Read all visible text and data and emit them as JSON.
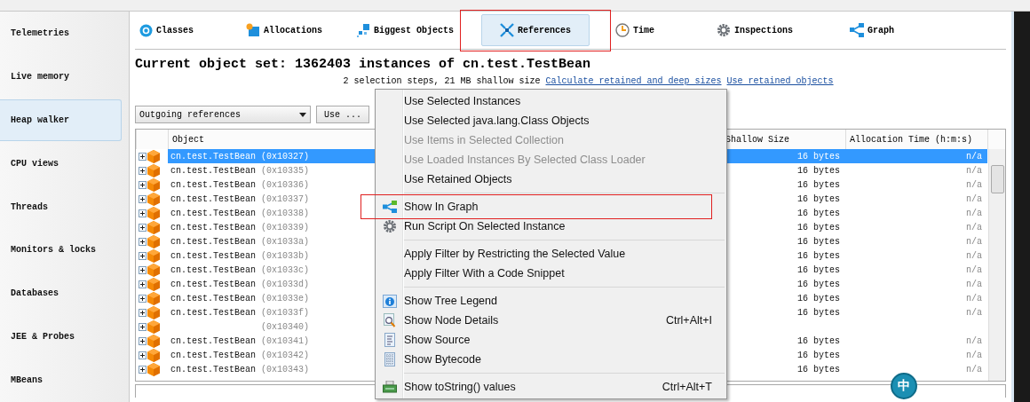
{
  "sidebar": {
    "items": [
      {
        "label": "Telemetries",
        "selected": false
      },
      {
        "label": "Live memory",
        "selected": false
      },
      {
        "label": "Heap walker",
        "selected": true
      },
      {
        "label": "CPU views",
        "selected": false
      },
      {
        "label": "Threads",
        "selected": false
      },
      {
        "label": "Monitors & locks",
        "selected": false
      },
      {
        "label": "Databases",
        "selected": false
      },
      {
        "label": "JEE & Probes",
        "selected": false
      },
      {
        "label": "MBeans",
        "selected": false
      }
    ]
  },
  "tabs": [
    {
      "label": "Classes",
      "selected": false,
      "highlighted": false
    },
    {
      "label": "Allocations",
      "selected": false,
      "highlighted": false
    },
    {
      "label": "Biggest Objects",
      "selected": false,
      "highlighted": false
    },
    {
      "label": "References",
      "selected": true,
      "highlighted": true
    },
    {
      "label": "Time",
      "selected": false,
      "highlighted": false
    },
    {
      "label": "Inspections",
      "selected": false,
      "highlighted": false
    },
    {
      "label": "Graph",
      "selected": false,
      "highlighted": false
    }
  ],
  "header": {
    "title": "Current object set: 1362403 instances of cn.test.TestBean",
    "subtitle": "2 selection steps, 21 MB shallow size",
    "links": [
      "Calculate retained and deep sizes",
      "Use retained objects"
    ]
  },
  "toolbar": {
    "view": "Outgoing references",
    "button": "Use ..."
  },
  "table": {
    "columns": [
      "Object",
      "Shallow Size",
      "Allocation Time (h:m:s)"
    ],
    "rows": [
      {
        "name": "cn.test.TestBean",
        "address": "(0x10327)",
        "size": "16 bytes",
        "time": "n/a",
        "selected": true
      },
      {
        "name": "cn.test.TestBean",
        "address": "(0x10335)",
        "size": "16 bytes",
        "time": "n/a",
        "selected": false
      },
      {
        "name": "cn.test.TestBean",
        "address": "(0x10336)",
        "size": "16 bytes",
        "time": "n/a",
        "selected": false
      },
      {
        "name": "cn.test.TestBean",
        "address": "(0x10337)",
        "size": "16 bytes",
        "time": "n/a",
        "selected": false
      },
      {
        "name": "cn.test.TestBean",
        "address": "(0x10338)",
        "size": "16 bytes",
        "time": "n/a",
        "selected": false
      },
      {
        "name": "cn.test.TestBean",
        "address": "(0x10339)",
        "size": "16 bytes",
        "time": "n/a",
        "selected": false
      },
      {
        "name": "cn.test.TestBean",
        "address": "(0x1033a)",
        "size": "16 bytes",
        "time": "n/a",
        "selected": false
      },
      {
        "name": "cn.test.TestBean",
        "address": "(0x1033b)",
        "size": "16 bytes",
        "time": "n/a",
        "selected": false
      },
      {
        "name": "cn.test.TestBean",
        "address": "(0x1033c)",
        "size": "16 bytes",
        "time": "n/a",
        "selected": false
      },
      {
        "name": "cn.test.TestBean",
        "address": "(0x1033d)",
        "size": "16 bytes",
        "time": "n/a",
        "selected": false
      },
      {
        "name": "cn.test.TestBean",
        "address": "(0x1033e)",
        "size": "16 bytes",
        "time": "n/a",
        "selected": false
      },
      {
        "name": "cn.test.TestBean",
        "address": "(0x1033f)",
        "size": "16 bytes",
        "time": "n/a",
        "selected": false
      },
      {
        "address": "(0x10340)",
        "selected": false
      },
      {
        "name": "cn.test.TestBean",
        "address": "(0x10341)",
        "size": "16 bytes",
        "time": "n/a",
        "selected": false
      },
      {
        "name": "cn.test.TestBean",
        "address": "(0x10342)",
        "size": "16 bytes",
        "time": "n/a",
        "selected": false
      },
      {
        "name": "cn.test.TestBean",
        "address": "(0x10343)",
        "size": "16 bytes",
        "time": "n/a",
        "selected": false
      }
    ]
  },
  "context_menu": {
    "items": [
      {
        "kind": "item",
        "label": "Use Selected Instances",
        "disabled": false,
        "highlighted": false
      },
      {
        "kind": "item",
        "label": "Use Selected java.lang.Class Objects",
        "disabled": false,
        "highlighted": false
      },
      {
        "kind": "item",
        "label": "Use Items in Selected Collection",
        "disabled": true,
        "highlighted": false
      },
      {
        "kind": "item",
        "label": "Use Loaded Instances By Selected Class Loader",
        "disabled": true,
        "highlighted": false
      },
      {
        "kind": "item",
        "label": "Use Retained Objects",
        "disabled": false,
        "highlighted": false
      },
      {
        "kind": "separator"
      },
      {
        "kind": "item",
        "label": "Show In Graph",
        "disabled": false,
        "highlighted": true
      },
      {
        "kind": "item",
        "label": "Run Script On Selected Instance",
        "disabled": false,
        "highlighted": false
      },
      {
        "kind": "separator"
      },
      {
        "kind": "item",
        "label": "Apply Filter by Restricting the Selected Value",
        "disabled": false,
        "highlighted": false
      },
      {
        "kind": "item",
        "label": "Apply Filter With a Code Snippet",
        "disabled": false,
        "highlighted": false
      },
      {
        "kind": "separator"
      },
      {
        "kind": "item",
        "label": "Show Tree Legend",
        "disabled": false,
        "highlighted": false
      },
      {
        "kind": "item",
        "label": "Show Node Details",
        "disabled": false,
        "highlighted": false,
        "shortcut": "Ctrl+Alt+I"
      },
      {
        "kind": "item",
        "label": "Show Source",
        "disabled": false,
        "highlighted": false
      },
      {
        "kind": "item",
        "label": "Show Bytecode",
        "disabled": false,
        "highlighted": false
      },
      {
        "kind": "separator"
      },
      {
        "kind": "item",
        "label": "Show toString() values",
        "disabled": false,
        "highlighted": false,
        "shortcut": "Ctrl+Alt+T"
      }
    ]
  },
  "ime_badge": "中"
}
